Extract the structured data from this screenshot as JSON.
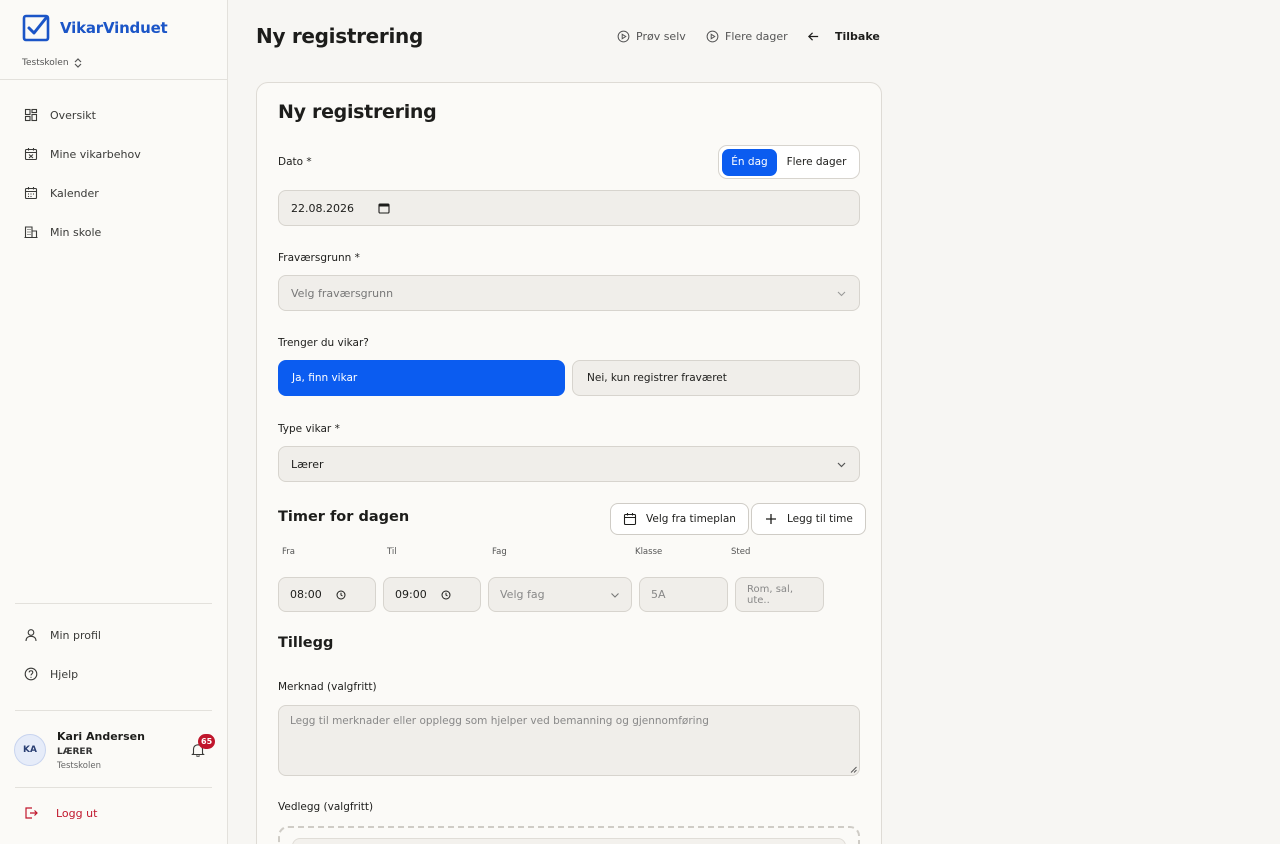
{
  "app": {
    "name": "VikarVinduet",
    "school": "Testskolen"
  },
  "sidebar": {
    "items": [
      {
        "label": "Oversikt",
        "icon": "dashboard-icon"
      },
      {
        "label": "Mine vikarbehov",
        "icon": "calendar-x-icon"
      },
      {
        "label": "Kalender",
        "icon": "calendar-icon"
      },
      {
        "label": "Min skole",
        "icon": "building-icon"
      }
    ],
    "bottom_items": [
      {
        "label": "Min profil",
        "icon": "user-icon"
      },
      {
        "label": "Hjelp",
        "icon": "help-icon"
      }
    ],
    "user": {
      "initials": "KA",
      "name": "Kari Andersen",
      "role": "LÆRER",
      "school": "Testskolen",
      "notification_count": "65"
    },
    "logout_label": "Logg ut"
  },
  "header": {
    "title": "Ny registrering",
    "links": [
      {
        "label": "Prøv selv",
        "icon": "play-circle-icon"
      },
      {
        "label": "Flere dager",
        "icon": "play-circle-icon"
      }
    ],
    "back_label": "Tilbake"
  },
  "form": {
    "title": "Ny registrering",
    "date_label": "Dato *",
    "mode": {
      "one_day": "Én dag",
      "multi_days": "Flere dager",
      "selected": "Én dag"
    },
    "date_value": "22.08.2026",
    "reason_label": "Fraværsgrunn *",
    "reason_placeholder": "Velg fraværsgrunn",
    "need_sub_label": "Trenger du vikar?",
    "need_sub_yes": "Ja, finn vikar",
    "need_sub_no": "Nei, kun registrer fraværet",
    "sub_type_label": "Type vikar *",
    "sub_type_value": "Lærer",
    "hours_title": "Timer for dagen",
    "pick_schedule_label": "Velg fra timeplan",
    "add_hour_label": "Legg til time",
    "columns": {
      "from": "Fra",
      "to": "Til",
      "subject": "Fag",
      "class": "Klasse",
      "place": "Sted"
    },
    "row": {
      "from": "08:00",
      "to": "09:00",
      "subject_placeholder": "Velg fag",
      "class_placeholder": "5A",
      "place_placeholder": "Rom, sal, ute.."
    },
    "extras_title": "Tillegg",
    "note_label": "Merknad (valgfritt)",
    "note_placeholder": "Legg til merknader eller opplegg som hjelper ved bemanning og gjennomføring",
    "attachment_label": "Vedlegg (valgfritt)"
  },
  "colors": {
    "accent": "#0b5cf0",
    "danger": "#c0162c",
    "brand": "#1b55c7"
  }
}
